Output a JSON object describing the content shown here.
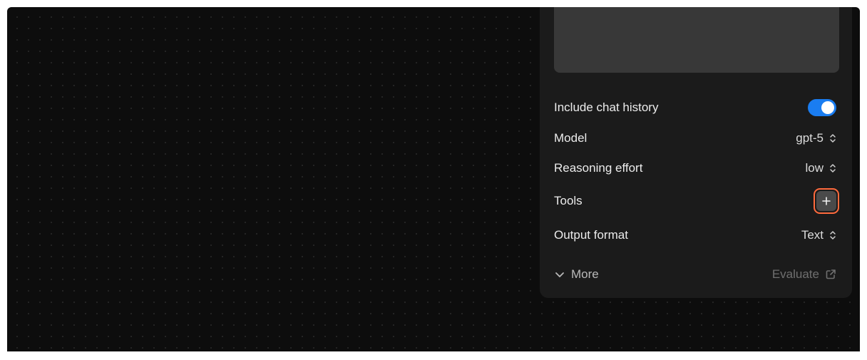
{
  "panel": {
    "include_history": {
      "label": "Include chat history",
      "enabled": true
    },
    "model": {
      "label": "Model",
      "value": "gpt-5"
    },
    "reasoning": {
      "label": "Reasoning effort",
      "value": "low"
    },
    "tools": {
      "label": "Tools",
      "add_icon": "plus-icon"
    },
    "output_format": {
      "label": "Output format",
      "value": "Text"
    },
    "footer": {
      "more_label": "More",
      "more_icon": "chevron-down-icon",
      "evaluate_label": "Evaluate",
      "evaluate_icon": "external-link-icon"
    }
  },
  "colors": {
    "toggle_on": "#1a7df1",
    "highlight_border": "#ff6a3d",
    "canvas_bg": "#0d0d0d",
    "panel_bg": "#1b1b1b"
  }
}
